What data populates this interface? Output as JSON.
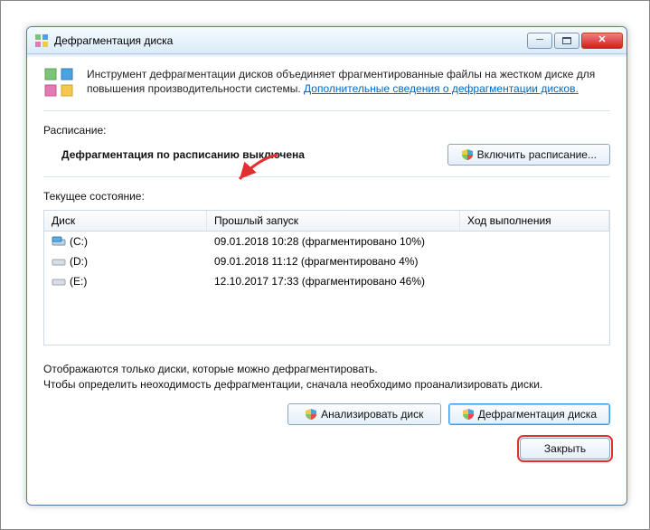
{
  "titlebar": {
    "title": "Дефрагментация диска"
  },
  "intro": {
    "text": "Инструмент дефрагментации дисков объединяет фрагментированные файлы на жестком диске для повышения производительности системы. ",
    "link": "Дополнительные сведения о дефрагментации дисков."
  },
  "schedule": {
    "label": "Расписание:",
    "status": "Дефрагментация по расписанию выключена",
    "button": "Включить расписание..."
  },
  "state": {
    "label": "Текущее состояние:",
    "columns": [
      "Диск",
      "Прошлый запуск",
      "Ход выполнения"
    ],
    "rows": [
      {
        "disk": "(C:)",
        "last": "09.01.2018 10:28 (фрагментировано 10%)",
        "progress": ""
      },
      {
        "disk": "(D:)",
        "last": "09.01.2018 11:12 (фрагментировано 4%)",
        "progress": ""
      },
      {
        "disk": "(E:)",
        "last": "12.10.2017 17:33 (фрагментировано 46%)",
        "progress": ""
      }
    ]
  },
  "note": {
    "line1": "Отображаются только диски, которые можно дефрагментировать.",
    "line2": "Чтобы определить неоходимость дефрагментации, сначала необходимо проанализировать диски."
  },
  "actions": {
    "analyze": "Анализировать диск",
    "defragment": "Дефрагментация диска",
    "close": "Закрыть"
  },
  "colors": {
    "accent": "#3d9be9",
    "highlight": "#e03030"
  }
}
